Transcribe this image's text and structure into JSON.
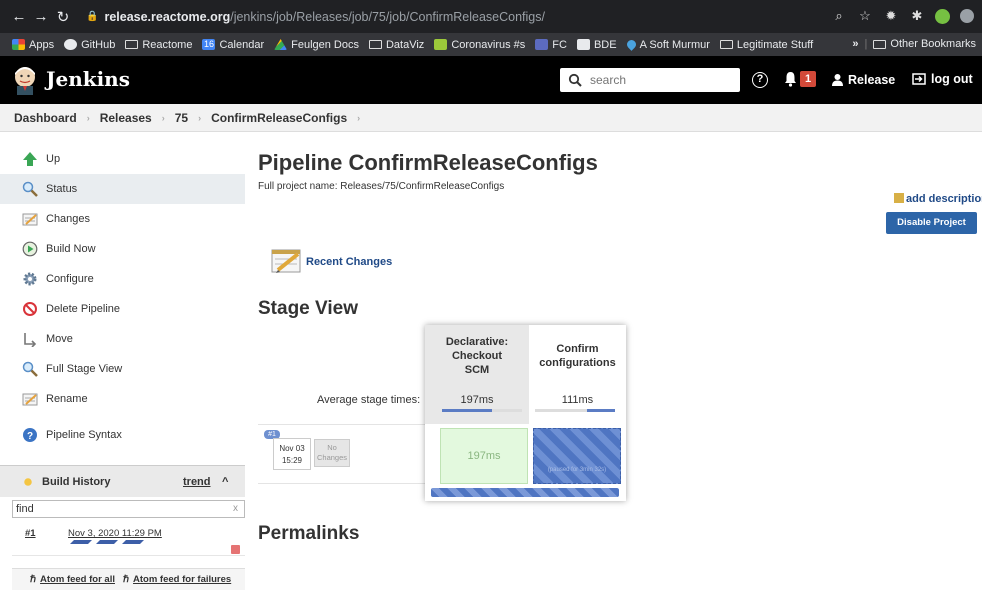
{
  "browser": {
    "url_host": "release.reactome.org",
    "url_path": "/jenkins/job/Releases/job/75/job/ConfirmReleaseConfigs/",
    "bookmarks": [
      "Apps",
      "GitHub",
      "Reactome",
      "Calendar",
      "Feulgen Docs",
      "DataViz",
      "Coronavirus #s",
      "FC",
      "BDE",
      "A Soft Murmur",
      "Legitimate Stuff"
    ],
    "calendar_icon_text": "16",
    "bookmarks_overflow": "»",
    "other_bookmarks": "Other Bookmarks"
  },
  "header": {
    "title": "Jenkins",
    "search_placeholder": "search",
    "help_label": "?",
    "notification_count": "1",
    "user": "Release",
    "logout": "log out"
  },
  "breadcrumb": [
    "Dashboard",
    "Releases",
    "75",
    "ConfirmReleaseConfigs"
  ],
  "sidebar": {
    "tasks": [
      {
        "label": "Up",
        "icon": "up-arrow-icon"
      },
      {
        "label": "Status",
        "icon": "magnifier-icon"
      },
      {
        "label": "Changes",
        "icon": "notepad-icon"
      },
      {
        "label": "Build Now",
        "icon": "clock-play-icon"
      },
      {
        "label": "Configure",
        "icon": "gear-icon"
      },
      {
        "label": "Delete Pipeline",
        "icon": "no-entry-icon"
      },
      {
        "label": "Move",
        "icon": "move-icon"
      },
      {
        "label": "Full Stage View",
        "icon": "magnifier-icon"
      },
      {
        "label": "Rename",
        "icon": "notepad-icon"
      },
      {
        "label": "Pipeline Syntax",
        "icon": "help-icon"
      }
    ],
    "build_history": {
      "title": "Build History",
      "trend": "trend",
      "caret": "^",
      "filter_value": "find",
      "filter_clear": "x",
      "builds": [
        {
          "number": "#1",
          "date": "Nov 3, 2020 11:29 PM"
        }
      ]
    },
    "feeds": {
      "all": "Atom feed for all",
      "failures": "Atom feed for failures"
    }
  },
  "main": {
    "title": "Pipeline ConfirmReleaseConfigs",
    "full_name": "Full project name: Releases/75/ConfirmReleaseConfigs",
    "add_description": "add description",
    "disable_button": "Disable Project",
    "recent_changes": "Recent Changes",
    "stage_view_title": "Stage View",
    "permalinks_title": "Permalinks"
  },
  "stage_view": {
    "average_label": "Average stage times:",
    "stages": [
      {
        "name": "Declarative: Checkout SCM",
        "avg": "197ms",
        "avg_fraction": 0.62
      },
      {
        "name": "Confirm configurations",
        "avg": "111ms",
        "avg_fraction": 0.35
      }
    ],
    "run": {
      "badge": "#1",
      "month_day": "Nov 03",
      "time": "15:29",
      "changes": "No Changes",
      "cells": [
        {
          "text": "197ms",
          "status": "success"
        },
        {
          "text": "(paused for 3min 32s)",
          "status": "in-progress"
        }
      ]
    },
    "colors": {
      "success": "#e3f9de",
      "running": "#4f75c2",
      "button": "#2d65a8"
    }
  }
}
